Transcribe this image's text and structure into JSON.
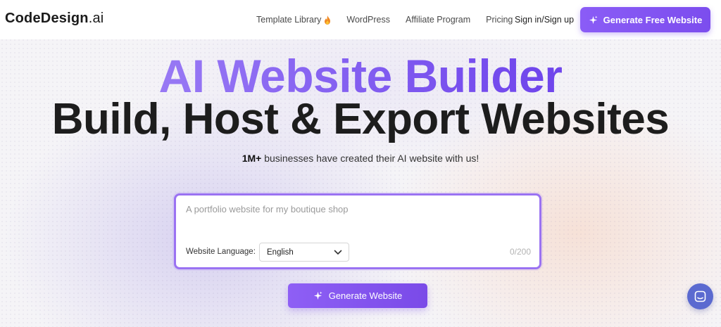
{
  "header": {
    "logo_main": "CodeDesign",
    "logo_suffix": ".ai",
    "nav": [
      {
        "label": "Template Library",
        "icon": "fire-icon"
      },
      {
        "label": "WordPress"
      },
      {
        "label": "Affiliate Program"
      },
      {
        "label": "Pricing"
      }
    ],
    "signin_label": "Sign in/Sign up",
    "cta_label": "Generate Free Website",
    "cta_icon": "sparkle-icon"
  },
  "hero": {
    "title_line1": "AI Website Builder",
    "title_line2": "Build, Host & Export Websites",
    "sub_bold": "1M+",
    "sub_rest": " businesses have created their AI website with us!"
  },
  "prompt": {
    "placeholder": "A portfolio website for my boutique shop",
    "value": "",
    "language_label": "Website Language:",
    "language_selected": "English",
    "counter": "0/200"
  },
  "generate_button": {
    "label": "Generate Website",
    "icon": "sparkle-icon"
  },
  "chat": {
    "icon": "chat-icon"
  },
  "colors": {
    "accent": "#7c4dee",
    "accent_light": "#a98ff7",
    "chat": "#5b6ad0"
  }
}
